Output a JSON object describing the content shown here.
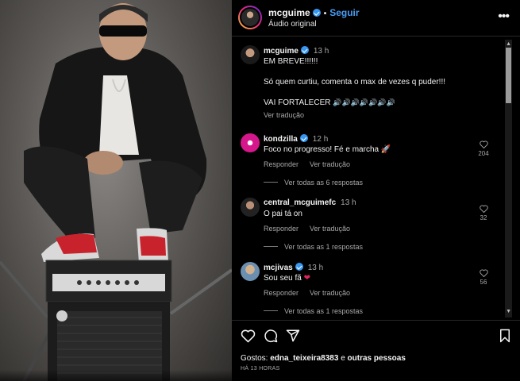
{
  "post": {
    "username": "mcguime",
    "follow_label": "Seguir",
    "separator": "•",
    "audio_label": "Áudio original"
  },
  "caption": {
    "username": "mcguime",
    "time": "13 h",
    "line1": "EM BREVE!!!!!!",
    "line2": "Só quem curtiu, comenta o max de vezes q puder!!!",
    "line3": "VAI FORTALECER",
    "line3_emoji": "🔊🔊🔊🔊🔊🔊🔊",
    "translate": "Ver tradução"
  },
  "comments": [
    {
      "username": "kondzilla",
      "time": "12 h",
      "text": "Foco no progresso! Fé e marcha",
      "emoji": "🚀",
      "reply": "Responder",
      "translate": "Ver tradução",
      "replies": "Ver todas as 6 respostas",
      "likes": "204"
    },
    {
      "username": "central_mcguimefc",
      "time": "13 h",
      "text": "O pai tá on",
      "emoji": "",
      "reply": "Responder",
      "translate": "Ver tradução",
      "replies": "Ver todas as 1 respostas",
      "likes": "32"
    },
    {
      "username": "mcjivas",
      "time": "13 h",
      "text": "Sou seu fã",
      "emoji": "❤",
      "reply": "Responder",
      "translate": "Ver tradução",
      "replies": "Ver todas as 1 respostas",
      "likes": "56"
    }
  ],
  "footer": {
    "likes_prefix": "Gostos:",
    "likes_user": "edna_teixeira8383",
    "likes_and": "e",
    "likes_others": "outras pessoas",
    "time_ago": "HÁ 13 HORAS"
  },
  "icons": [
    "more-options-icon",
    "heart-icon",
    "comment-icon",
    "share-icon",
    "bookmark-icon",
    "verified-icon",
    "scroll-up-icon",
    "scroll-down-icon"
  ],
  "colors": {
    "background": "#000000",
    "follow": "#4a9cf3",
    "verified": "#3897f0",
    "secondary_text": "#a8a8a8",
    "red_heart": "#e0245e"
  }
}
